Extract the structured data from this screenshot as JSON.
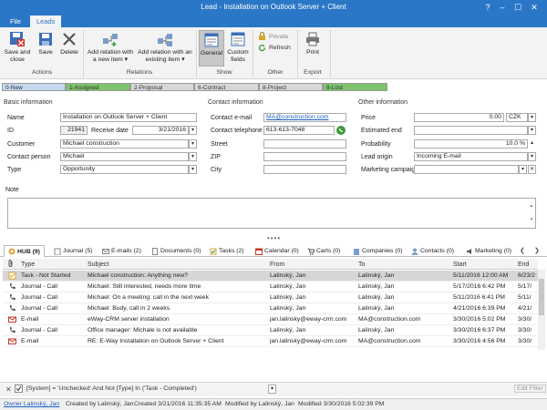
{
  "window": {
    "title": "Lead - Installation on Outlook Server + Client",
    "min": "–",
    "max": "☐",
    "close": "✕",
    "help": "?"
  },
  "ribbon_tabs": [
    {
      "label": "File"
    },
    {
      "label": "Leads"
    }
  ],
  "ribbon": {
    "actions": {
      "group": "Actions",
      "save_close": "Save and close",
      "save": "Save",
      "delete": "Delete"
    },
    "relations": {
      "group": "Relations",
      "add_new": "Add relation with a new item ▾",
      "add_existing": "Add relation with an existing item ▾"
    },
    "show": {
      "group": "Show",
      "general": "General",
      "custom": "Custom fields"
    },
    "other": {
      "group": "Other",
      "private": "Private",
      "refresh": "Refresh"
    },
    "export": {
      "group": "Export",
      "print": "Print"
    }
  },
  "workflow": [
    {
      "label": "0-New",
      "color": "#c5d9f1"
    },
    {
      "label": "1-Assigned",
      "color": "#7dc36b"
    },
    {
      "label": "2-Proposal",
      "color": "#d8d8d8"
    },
    {
      "label": "6-Contract",
      "color": "#d8d8d8"
    },
    {
      "label": "8-Project",
      "color": "#d8d8d8"
    },
    {
      "label": "9-Lost",
      "color": "#7dc36b"
    }
  ],
  "basic": {
    "section": "Basic information",
    "name_label": "Name",
    "name": "Installation on Outlook Server + Client",
    "id_label": "ID",
    "id": "21941",
    "receive_label": "Receive date",
    "receive": "3/21/2016",
    "customer_label": "Customer",
    "customer": "Michael construction",
    "contact_label": "Contact person",
    "contact": "Michael",
    "type_label": "Type",
    "type": "Opportunity"
  },
  "contact": {
    "section": "Contact information",
    "email_label": "Contact e-mail",
    "email": "MA@construction.com",
    "phone_label": "Contact telephone",
    "phone": "613-613-7048",
    "street_label": "Street",
    "zip_label": "ZIP",
    "city_label": "City"
  },
  "other": {
    "section": "Other information",
    "price_label": "Price",
    "price": "0.00",
    "currency": "CZK",
    "estimated_label": "Estimated end",
    "probability_label": "Probability",
    "probability": "10.0 %",
    "origin_label": "Lead origin",
    "origin": "Incoming E-mail",
    "campaign_label": "Marketing campaign"
  },
  "note": {
    "label": "Note"
  },
  "bottom_tabs": [
    {
      "label": "HUB (9)"
    },
    {
      "label": "Journal (5)"
    },
    {
      "label": "E-mails (2)"
    },
    {
      "label": "Documents (0)"
    },
    {
      "label": "Tasks (2)"
    },
    {
      "label": "Calendar (0)"
    },
    {
      "label": "Carts (0)"
    },
    {
      "label": "Companies (0)"
    },
    {
      "label": "Contacts (0)"
    },
    {
      "label": "Marketing (0)"
    }
  ],
  "grid": {
    "headers": {
      "type": "Type",
      "subject": "Subject",
      "from": "From",
      "to": "To",
      "start": "Start",
      "end": "End"
    },
    "rows": [
      {
        "type": "Task - Not Started",
        "subject": "Michael construction: Anything new?",
        "from": "Lalinský, Jan",
        "to": "Lalinský, Jan",
        "start": "5/11/2016 12:00 AM",
        "end": "6/23/2"
      },
      {
        "type": "Journal - Call",
        "subject": "Michael: Still interested, needs more time",
        "from": "Lalinský, Jan",
        "to": "Lalinský, Jan",
        "start": "5/17/2016 6:42 PM",
        "end": "5/17/"
      },
      {
        "type": "Journal - Call",
        "subject": "Michael: On a meeting: call in the next week",
        "from": "Lalinský, Jan",
        "to": "Lalinský, Jan",
        "start": "5/11/2016 6:41 PM",
        "end": "5/11/"
      },
      {
        "type": "Journal - Call",
        "subject": "Michael: Budy, call in 2 weeks",
        "from": "Lalinský, Jan",
        "to": "Lalinský, Jan",
        "start": "4/21/2016 6:39 PM",
        "end": "4/21/"
      },
      {
        "type": "E-mail",
        "subject": "eWay-CRM server installation",
        "from": "jan.lalinsky@eway-crm.com",
        "to": "MA@construction.com",
        "start": "3/30/2016 5:02 PM",
        "end": "3/30/"
      },
      {
        "type": "Journal - Call",
        "subject": "Office manager: Michale is not available",
        "from": "Lalinský, Jan",
        "to": "Lalinský, Jan",
        "start": "3/30/2016 6:37 PM",
        "end": "3/30/"
      },
      {
        "type": "E-mail",
        "subject": "RE: E-Way Installation on Outlook Server + Client",
        "from": "jan.lalinsky@eway-crm.com",
        "to": "MA@construction.com",
        "start": "3/30/2016 4:56 PM",
        "end": "3/30/"
      }
    ]
  },
  "filter": {
    "text": "[System] = 'Unchecked' And Not [Type] In ('Task - Completed')",
    "edit": "Edit Filter"
  },
  "status": {
    "owner": "Owner Lalinský, Jan",
    "created_by": "Created by Lalinský, Jan",
    "created": "Created 3/21/2016 11:35:35 AM",
    "modified_by": "Modified by Lalinský, Jan",
    "modified": "Modified 3/30/2016 5:02:39 PM"
  }
}
